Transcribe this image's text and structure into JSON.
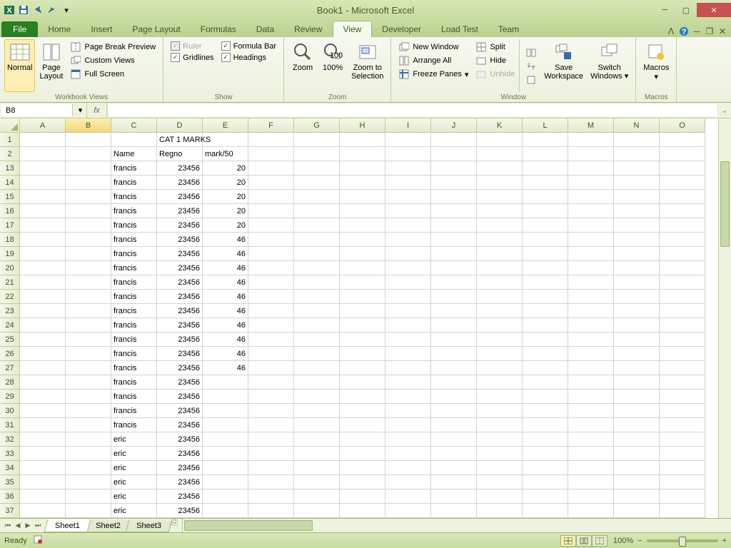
{
  "title": "Book1 - Microsoft Excel",
  "tabs": {
    "file": "File",
    "home": "Home",
    "insert": "Insert",
    "pagelayout": "Page Layout",
    "formulas": "Formulas",
    "data": "Data",
    "review": "Review",
    "view": "View",
    "developer": "Developer",
    "loadtest": "Load Test",
    "team": "Team"
  },
  "ribbon": {
    "workbookviews": {
      "label": "Workbook Views",
      "normal": "Normal",
      "pagelayout": "Page Layout",
      "pagebreak": "Page Break Preview",
      "custom": "Custom Views",
      "full": "Full Screen"
    },
    "show": {
      "label": "Show",
      "ruler": "Ruler",
      "formulabar": "Formula Bar",
      "gridlines": "Gridlines",
      "headings": "Headings"
    },
    "zoom": {
      "label": "Zoom",
      "zoom": "Zoom",
      "hundred": "100%",
      "selection": "Zoom to Selection"
    },
    "window": {
      "label": "Window",
      "new": "New Window",
      "arrange": "Arrange All",
      "freeze": "Freeze Panes",
      "split": "Split",
      "hide": "Hide",
      "unhide": "Unhide",
      "save": "Save Workspace",
      "switch": "Switch Windows"
    },
    "macros": {
      "label": "Macros",
      "macros": "Macros"
    }
  },
  "namebox": "B8",
  "formula": "",
  "columns": [
    "A",
    "B",
    "C",
    "D",
    "E",
    "F",
    "G",
    "H",
    "I",
    "J",
    "K",
    "L",
    "M",
    "N",
    "O"
  ],
  "rownums": [
    1,
    2,
    13,
    14,
    15,
    16,
    17,
    18,
    19,
    20,
    21,
    22,
    23,
    24,
    25,
    26,
    27,
    28,
    29,
    30,
    31,
    32,
    33,
    34,
    35,
    36,
    37
  ],
  "titlecell": "CAT 1 MARKS",
  "headers": {
    "c": "Name",
    "d": "Regno",
    "e": "mark/50"
  },
  "data": [
    {
      "c": "francis",
      "d": "23456",
      "e": "20"
    },
    {
      "c": "francis",
      "d": "23456",
      "e": "20"
    },
    {
      "c": "francis",
      "d": "23456",
      "e": "20"
    },
    {
      "c": "francis",
      "d": "23456",
      "e": "20"
    },
    {
      "c": "francis",
      "d": "23456",
      "e": "20"
    },
    {
      "c": "francis",
      "d": "23456",
      "e": "46"
    },
    {
      "c": "francis",
      "d": "23456",
      "e": "46"
    },
    {
      "c": "francis",
      "d": "23456",
      "e": "46"
    },
    {
      "c": "francis",
      "d": "23456",
      "e": "46"
    },
    {
      "c": "francis",
      "d": "23456",
      "e": "46"
    },
    {
      "c": "francis",
      "d": "23456",
      "e": "46"
    },
    {
      "c": "francis",
      "d": "23456",
      "e": "46"
    },
    {
      "c": "francis",
      "d": "23456",
      "e": "46"
    },
    {
      "c": "francis",
      "d": "23456",
      "e": "46"
    },
    {
      "c": "francis",
      "d": "23456",
      "e": "46"
    },
    {
      "c": "francis",
      "d": "23456",
      "e": ""
    },
    {
      "c": "francis",
      "d": "23456",
      "e": ""
    },
    {
      "c": "francis",
      "d": "23456",
      "e": ""
    },
    {
      "c": "francis",
      "d": "23456",
      "e": ""
    },
    {
      "c": "eric",
      "d": "23456",
      "e": ""
    },
    {
      "c": "eric",
      "d": "23456",
      "e": ""
    },
    {
      "c": "eric",
      "d": "23456",
      "e": ""
    },
    {
      "c": "eric",
      "d": "23456",
      "e": ""
    },
    {
      "c": "eric",
      "d": "23456",
      "e": ""
    },
    {
      "c": "eric",
      "d": "23456",
      "e": ""
    }
  ],
  "sheets": [
    "Sheet1",
    "Sheet2",
    "Sheet3"
  ],
  "status": {
    "ready": "Ready",
    "zoom": "100%"
  }
}
